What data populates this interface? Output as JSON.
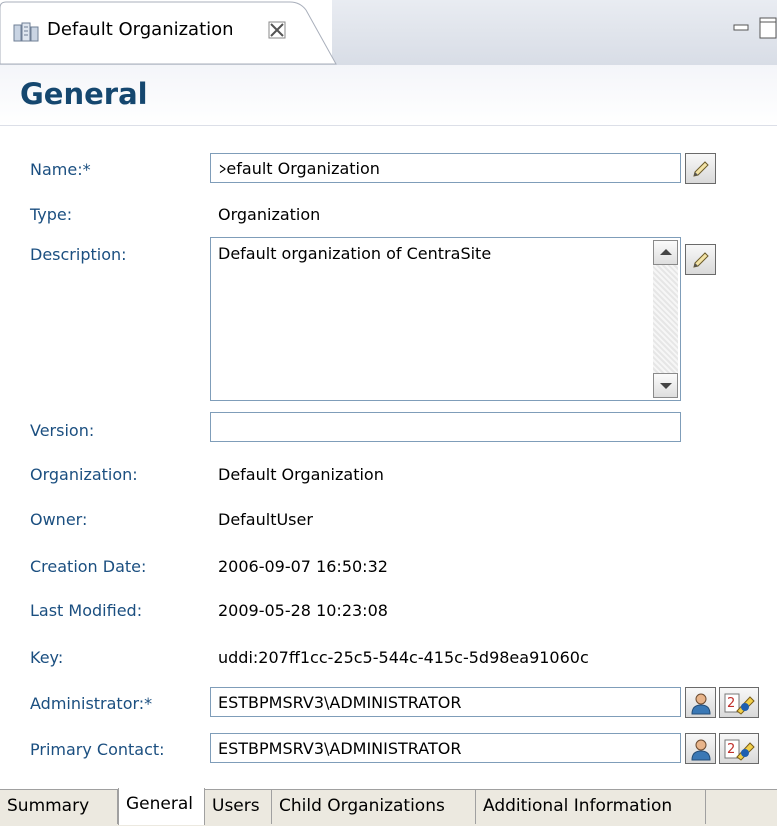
{
  "editor": {
    "tab_title": "Default Organization",
    "tab_icon": "organization-icon",
    "close_icon": "close-icon",
    "minimize_icon": "minimize-icon",
    "maximize_icon": "maximize-icon"
  },
  "page": {
    "title": "General"
  },
  "form": {
    "name_label": "Name:*",
    "name_value": "Default Organization",
    "name_display_prefix": ">",
    "name_display_rest": "efault Organization",
    "type_label": "Type:",
    "type_value": "Organization",
    "description_label": "Description:",
    "description_value": "Default organization of CentraSite",
    "version_label": "Version:",
    "version_value": "",
    "organization_label": "Organization:",
    "organization_value": "Default Organization",
    "owner_label": "Owner:",
    "owner_value": "DefaultUser",
    "creation_date_label": "Creation Date:",
    "creation_date_value": "2006-09-07 16:50:32",
    "last_modified_label": "Last Modified:",
    "last_modified_value": "2009-05-28 10:23:08",
    "key_label": "Key:",
    "key_value": "uddi:207ff1cc-25c5-544c-415c-5d98ea91060c",
    "administrator_label": "Administrator:*",
    "administrator_value": "ESTBPMSRV3\\ADMINISTRATOR",
    "primary_contact_label": "Primary Contact:",
    "primary_contact_value": "ESTBPMSRV3\\ADMINISTRATOR"
  },
  "bottom_tabs": [
    {
      "label": "Summary"
    },
    {
      "label": "General",
      "active": true
    },
    {
      "label": "Users"
    },
    {
      "label": "Child Organizations"
    },
    {
      "label": "Additional Information"
    }
  ],
  "colors": {
    "label": "#1b4f80",
    "title": "#15476f",
    "field_border": "#7f9db9"
  }
}
